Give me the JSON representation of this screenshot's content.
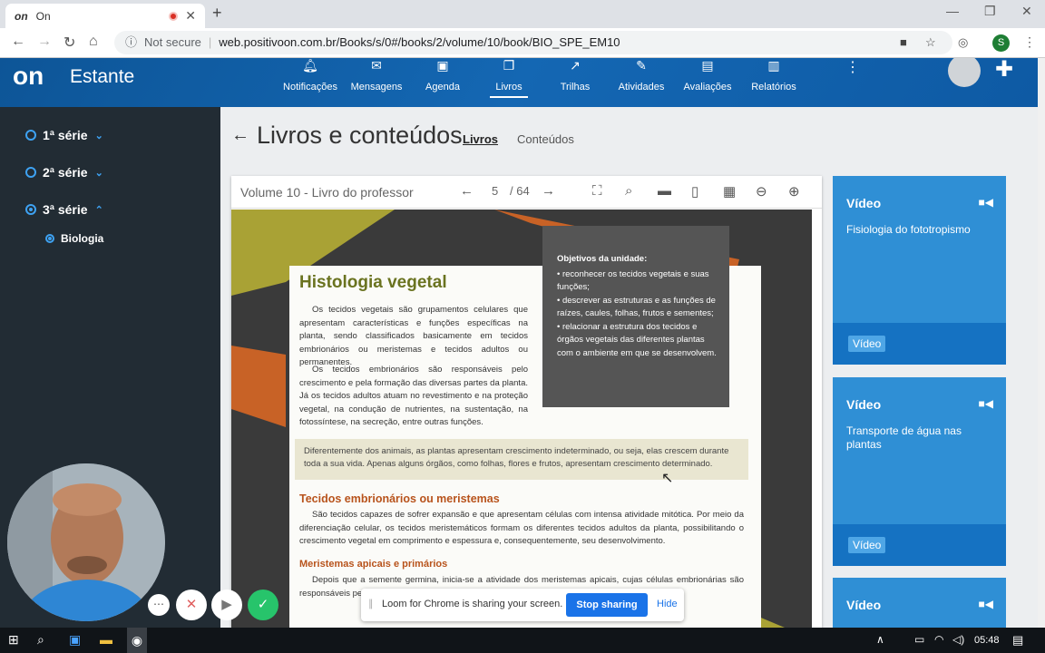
{
  "browser": {
    "tab_title": "On",
    "tab_favicon": "on",
    "url_prefix": "Not secure",
    "url": "web.positivoon.com.br/Books/s/0#/books/2/volume/10/book/BIO_SPE_EM10",
    "profile_initial": "S"
  },
  "app": {
    "logo": "on",
    "section": "Estante",
    "nav": [
      {
        "label": "Notificações",
        "icon": "bell-icon"
      },
      {
        "label": "Mensagens",
        "icon": "mail-icon"
      },
      {
        "label": "Agenda",
        "icon": "calendar-icon"
      },
      {
        "label": "Livros",
        "icon": "books-icon"
      },
      {
        "label": "Trilhas",
        "icon": "trend-icon"
      },
      {
        "label": "Atividades",
        "icon": "edit-icon"
      },
      {
        "label": "Avaliações",
        "icon": "clipboard-icon"
      },
      {
        "label": "Relatórios",
        "icon": "bar-chart-icon"
      }
    ]
  },
  "sidebar": {
    "items": [
      {
        "label": "1ª série",
        "selected": false
      },
      {
        "label": "2ª série",
        "selected": false
      },
      {
        "label": "3ª série",
        "selected": true
      }
    ],
    "subitem": "Biologia"
  },
  "page": {
    "title": "Livros e conteúdos",
    "tabs": [
      "Livros",
      "Conteúdos"
    ]
  },
  "viewer": {
    "title": "Volume 10 - Livro do professor",
    "page_current": "5",
    "page_total": "/ 64"
  },
  "book": {
    "heading": "Histologia vegetal",
    "para1": "Os tecidos vegetais são grupamentos celulares que apresentam características e funções específicas na planta, sendo classificados basicamente em tecidos embrionários ou meristemas e tecidos adultos ou permanentes.",
    "para2": "Os tecidos embrionários são responsáveis pelo crescimento e pela formação das diversas partes da planta. Já os tecidos adultos atuam no revestimento e na proteção vegetal, na condução de nutrientes, na sustentação, na fotossíntese, na secreção, entre outras funções.",
    "objectives_title": "Objetivos da unidade:",
    "objectives": [
      "reconhecer os tecidos vegetais e suas funções;",
      "descrever as estruturas e as funções de raízes, caules, folhas, frutos e sementes;",
      "relacionar a estrutura dos tecidos e órgãos vegetais das diferentes plantas com o ambiente em que se desenvolvem."
    ],
    "note": "Diferentemente dos animais, as plantas apresentam crescimento indeterminado, ou seja, elas crescem durante toda a sua vida. Apenas alguns órgãos, como folhas, flores e frutos, apresentam crescimento determinado.",
    "sub1": "Tecidos embrionários ou meristemas",
    "para3": "São tecidos capazes de sofrer expansão e que apresentam células com intensa atividade mitótica. Por meio da diferenciação celular, os tecidos meristemáticos formam os diferentes tecidos adultos da planta, possibilitando o crescimento vegetal em comprimento e espessura e, consequentemente, seu desenvolvimento.",
    "sub2": "Meristemas apicais e primários",
    "para4": "Depois que a semente germina, inicia-se a atividade dos meristemas apicais, cujas células embrionárias são responsáveis pelo crescimento primário da planta, com o alongamento da raiz e do caule."
  },
  "cards": [
    {
      "type": "Vídeo",
      "title": "Fisiologia do fototropismo",
      "badge": "Vídeo"
    },
    {
      "type": "Vídeo",
      "title": "Transporte de água nas plantas",
      "badge": "Vídeo"
    },
    {
      "type": "Vídeo",
      "title": "",
      "badge": ""
    }
  ],
  "loom": {
    "message": "Loom for Chrome is sharing your screen.",
    "stop": "Stop sharing",
    "hide": "Hide"
  },
  "taskbar": {
    "time": "05:48"
  }
}
